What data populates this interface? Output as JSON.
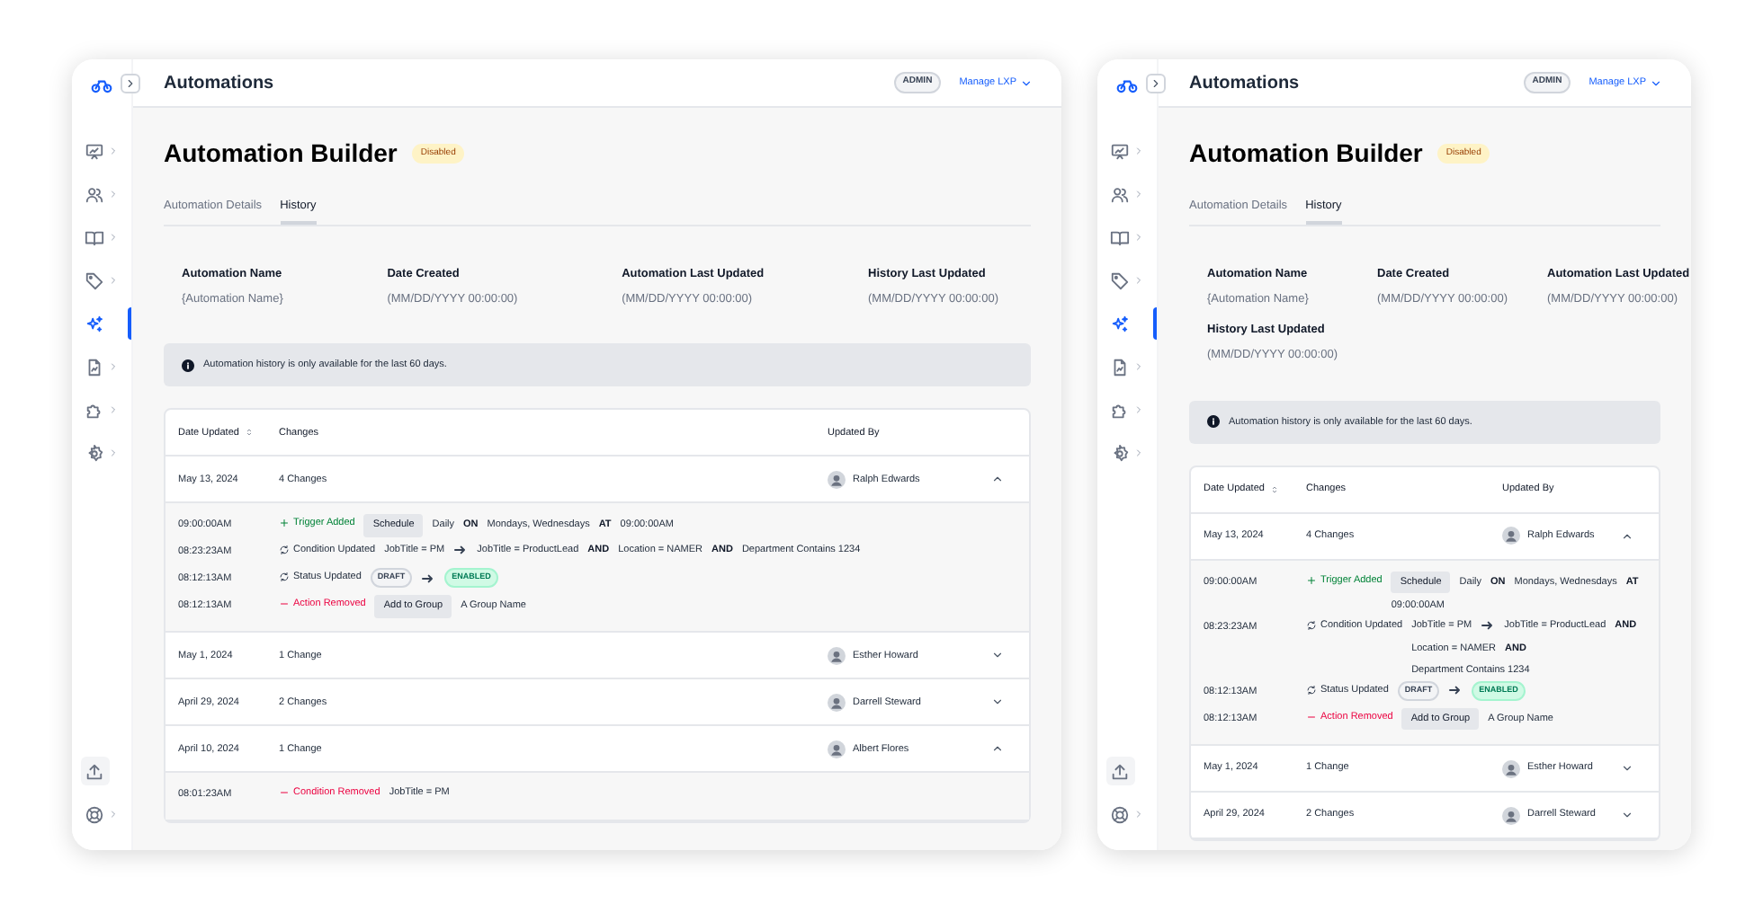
{
  "screens": [
    {
      "sidebar": {
        "items": [
          {
            "expandable": true,
            "selected": false
          },
          {
            "expandable": true,
            "selected": false
          },
          {
            "expandable": true,
            "selected": false
          },
          {
            "expandable": true,
            "selected": false
          },
          {
            "expandable": false,
            "selected": true
          },
          {
            "expandable": true,
            "selected": false
          },
          {
            "expandable": true,
            "selected": false
          },
          {
            "expandable": true,
            "selected": false
          }
        ],
        "footer_items": [
          {
            "expandable": false,
            "selected": false
          },
          {
            "expandable": true,
            "selected": false
          }
        ]
      },
      "header": {
        "title": "Automations",
        "role_badge": "ADMIN",
        "menu": "Manage LXP"
      },
      "page_title": "Automation Builder",
      "status_badge": "Disabled",
      "tabs": [
        {
          "label": "Automation Details",
          "selected": false
        },
        {
          "label": "History",
          "selected": true
        }
      ],
      "fields": [
        {
          "label": "Automation Name",
          "value": "{Automation Name}"
        },
        {
          "label": "Date Created",
          "value": "(MM/DD/YYYY 00:00:00)"
        },
        {
          "label": "Automation Last Updated",
          "value": "(MM/DD/YYYY 00:00:00)"
        },
        {
          "label": "History Last Updated",
          "value": "(MM/DD/YYYY 00:00:00)"
        }
      ],
      "notice": "Automation history is only available for the last 60 days.",
      "table": {
        "columns": [
          "Date Updated",
          "Changes",
          "Updated By"
        ],
        "rows": [
          {
            "date": "May 13, 2024",
            "changes": "4 Changes",
            "user": "Ralph Edwards",
            "expanded": true,
            "details": [
              {
                "time": "09:00:00AM",
                "kind": "added",
                "label": "Trigger Added",
                "tokens": [
                  {
                    "kind": "chip",
                    "text": "Schedule"
                  },
                  {
                    "kind": "text",
                    "text": "Daily"
                  },
                  {
                    "kind": "keyword",
                    "text": "ON"
                  },
                  {
                    "kind": "text",
                    "text": "Mondays, Wednesdays"
                  },
                  {
                    "kind": "keyword",
                    "text": "AT"
                  },
                  {
                    "kind": "text",
                    "text": "09:00:00AM"
                  }
                ]
              },
              {
                "time": "08:23:23AM",
                "kind": "updated",
                "label": "Condition Updated",
                "tokens": [
                  {
                    "kind": "text",
                    "text": "JobTitle = PM"
                  },
                  {
                    "kind": "arrow"
                  },
                  {
                    "kind": "text",
                    "text": "JobTitle = ProductLead"
                  },
                  {
                    "kind": "keyword",
                    "text": "AND"
                  },
                  {
                    "kind": "text",
                    "text": "Location = NAMER"
                  },
                  {
                    "kind": "keyword",
                    "text": "AND"
                  },
                  {
                    "kind": "text",
                    "text": "Department Contains 1234"
                  }
                ]
              },
              {
                "time": "08:12:13AM",
                "kind": "updated",
                "label": "Status Updated",
                "tokens": [
                  {
                    "kind": "neutralbadge",
                    "text": "DRAFT"
                  },
                  {
                    "kind": "arrow"
                  },
                  {
                    "kind": "successbadge",
                    "text": "ENABLED"
                  }
                ]
              },
              {
                "time": "08:12:13AM",
                "kind": "removed",
                "label": "Action Removed",
                "tokens": [
                  {
                    "kind": "chip",
                    "text": "Add to Group"
                  },
                  {
                    "kind": "text",
                    "text": "A Group Name"
                  }
                ]
              }
            ]
          },
          {
            "date": "May 1, 2024",
            "changes": "1 Change",
            "user": "Esther Howard",
            "expanded": false
          },
          {
            "date": "April 29, 2024",
            "changes": "2 Changes",
            "user": "Darrell Steward",
            "expanded": false
          },
          {
            "date": "April 10, 2024",
            "changes": "1 Change",
            "user": "Albert Flores",
            "expanded": true,
            "details": [
              {
                "time": "08:01:23AM",
                "kind": "removed",
                "label": "Condition Removed",
                "tokens": [
                  {
                    "kind": "text",
                    "text": "JobTitle = PM"
                  }
                ]
              }
            ]
          }
        ]
      }
    },
    {
      "sidebar": {
        "items": [
          {
            "expandable": true,
            "selected": false
          },
          {
            "expandable": true,
            "selected": false
          },
          {
            "expandable": true,
            "selected": false
          },
          {
            "expandable": true,
            "selected": false
          },
          {
            "expandable": false,
            "selected": true
          },
          {
            "expandable": true,
            "selected": false
          },
          {
            "expandable": true,
            "selected": false
          },
          {
            "expandable": true,
            "selected": false
          }
        ],
        "footer_items": [
          {
            "expandable": false,
            "selected": false
          },
          {
            "expandable": true,
            "selected": false
          }
        ]
      },
      "header": {
        "title": "Automations",
        "role_badge": "ADMIN",
        "menu": "Manage LXP"
      },
      "page_title": "Automation Builder",
      "status_badge": "Disabled",
      "tabs": [
        {
          "label": "Automation Details",
          "selected": false
        },
        {
          "label": "History",
          "selected": true
        }
      ],
      "fields": [
        {
          "label": "Automation Name",
          "value": "{Automation Name}"
        },
        {
          "label": "Date Created",
          "value": "(MM/DD/YYYY 00:00:00)"
        },
        {
          "label": "Automation Last Updated",
          "value": "(MM/DD/YYYY 00:00:00)"
        },
        {
          "label": "History Last Updated",
          "value": "(MM/DD/YYYY 00:00:00)"
        }
      ],
      "notice": "Automation history is only available for the last 60 days.",
      "table": {
        "columns": [
          "Date Updated",
          "Changes",
          "Updated By"
        ],
        "rows": [
          {
            "date": "May 13, 2024",
            "changes": "4 Changes",
            "user": "Ralph Edwards",
            "expanded": true,
            "details": [
              {
                "time": "09:00:00AM",
                "kind": "added",
                "label": "Trigger Added",
                "tokens": [
                  {
                    "kind": "chip",
                    "text": "Schedule"
                  },
                  {
                    "kind": "text",
                    "text": "Daily"
                  },
                  {
                    "kind": "keyword",
                    "text": "ON"
                  },
                  {
                    "kind": "text",
                    "text": "Mondays, Wednesdays"
                  },
                  {
                    "kind": "keyword",
                    "text": "AT"
                  },
                  {
                    "kind": "text",
                    "text": "09:00:00AM"
                  }
                ]
              },
              {
                "time": "08:23:23AM",
                "kind": "updated",
                "label": "Condition Updated",
                "tokens": [
                  {
                    "kind": "text",
                    "text": "JobTitle = PM"
                  },
                  {
                    "kind": "arrow"
                  },
                  {
                    "kind": "text",
                    "text": "JobTitle = ProductLead"
                  },
                  {
                    "kind": "keyword",
                    "text": "AND"
                  },
                  {
                    "kind": "text",
                    "text": "Location = NAMER"
                  },
                  {
                    "kind": "keyword",
                    "text": "AND"
                  },
                  {
                    "kind": "text",
                    "text": "Department Contains 1234"
                  }
                ]
              },
              {
                "time": "08:12:13AM",
                "kind": "updated",
                "label": "Status Updated",
                "tokens": [
                  {
                    "kind": "neutralbadge",
                    "text": "DRAFT"
                  },
                  {
                    "kind": "arrow"
                  },
                  {
                    "kind": "successbadge",
                    "text": "ENABLED"
                  }
                ]
              },
              {
                "time": "08:12:13AM",
                "kind": "removed",
                "label": "Action Removed",
                "tokens": [
                  {
                    "kind": "chip",
                    "text": "Add to Group"
                  },
                  {
                    "kind": "text",
                    "text": "A Group Name"
                  }
                ]
              }
            ]
          },
          {
            "date": "May 1, 2024",
            "changes": "1 Change",
            "user": "Esther Howard",
            "expanded": false
          },
          {
            "date": "April 29, 2024",
            "changes": "2 Changes",
            "user": "Darrell Steward",
            "expanded": false
          }
        ]
      }
    }
  ]
}
